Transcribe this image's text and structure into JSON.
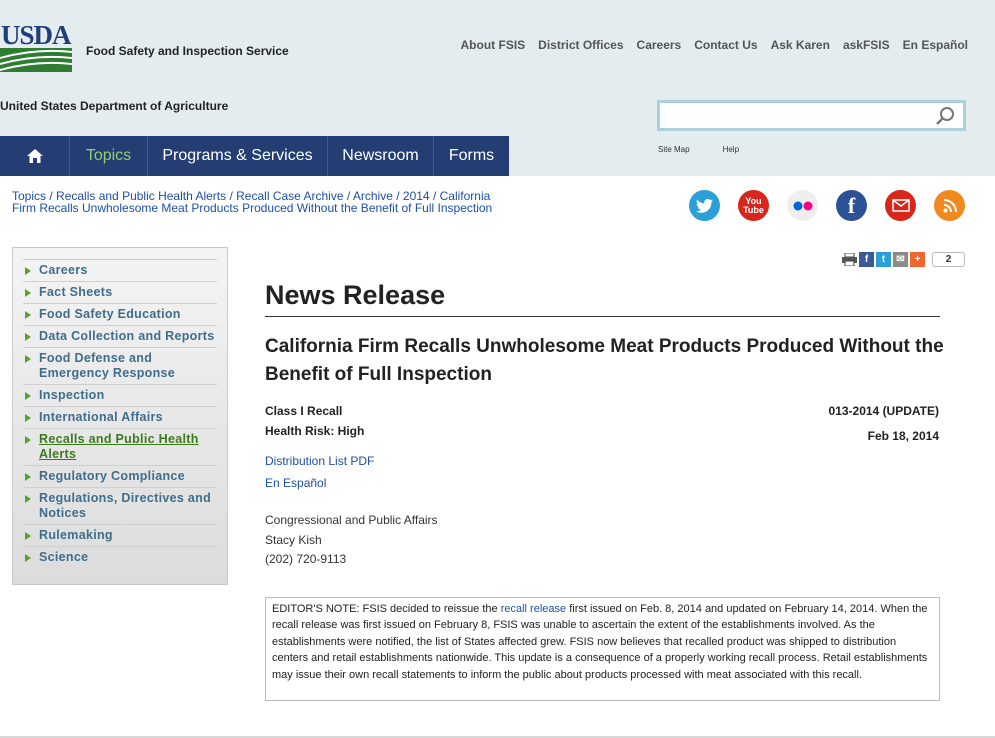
{
  "header": {
    "logo_text": "USDA",
    "agency": "Food Safety and Inspection Service",
    "department": "United States Department of Agriculture",
    "util_nav": [
      "About FSIS",
      "District Offices",
      "Careers",
      "Contact Us",
      "Ask Karen",
      "askFSIS",
      "En Español"
    ],
    "search": {
      "value": "",
      "placeholder": ""
    },
    "sub_links": [
      "Site Map",
      "Help"
    ]
  },
  "main_nav": {
    "items": [
      "Topics",
      "Programs & Services",
      "Newsroom",
      "Forms"
    ],
    "active": "Topics",
    "active_color": "#8dd36a",
    "bar_color": "#243d73"
  },
  "breadcrumb": [
    "Topics",
    "Recalls and Public Health Alerts",
    "Recall Case Archive",
    "Archive",
    "2014",
    "California Firm Recalls Unwholesome Meat Products Produced Without the Benefit of Full Inspection"
  ],
  "social_icons": [
    "twitter-icon",
    "youtube-icon",
    "flickr-icon",
    "facebook-icon",
    "email-icon",
    "rss-icon"
  ],
  "youtube_text": "You Tube",
  "share": {
    "count": "2"
  },
  "sidebar": {
    "items": [
      "Careers",
      "Fact Sheets",
      "Food Safety Education",
      "Data Collection and Reports",
      "Food Defense and Emergency Response",
      "Inspection",
      "International Affairs",
      "Recalls and Public Health Alerts",
      "Regulatory Compliance",
      "Regulations, Directives and Notices",
      "Rulemaking",
      "Science"
    ],
    "active_index": 7
  },
  "article": {
    "section_title": "News Release",
    "headline": "California Firm Recalls Unwholesome Meat Products Produced Without the Benefit of Full Inspection",
    "class": "Class I Recall",
    "health_risk": "Health Risk: High",
    "number": "013-2014 (UPDATE)",
    "date": "Feb 18, 2014",
    "links": [
      "Distribution List PDF",
      "En Español"
    ],
    "contact": [
      "Congressional and Public Affairs",
      "Stacy Kish",
      "(202) 720-9113"
    ],
    "note_before": "EDITOR'S NOTE: FSIS decided to reissue the ",
    "note_link": "recall release",
    "note_after": " first issued on Feb. 8, 2014 and updated on February 14, 2014. When the recall release was first issued on February 8, FSIS was unable to ascertain the extent of the establishments involved.  As the establishments were notified, the list of States affected grew.  FSIS now believes that recalled product was shipped to distribution centers and retail establishments nationwide.  This update is a consequence of a properly working recall process. Retail establishments may issue their own recall statements to inform the public about products processed with meat associated with this recall."
  }
}
